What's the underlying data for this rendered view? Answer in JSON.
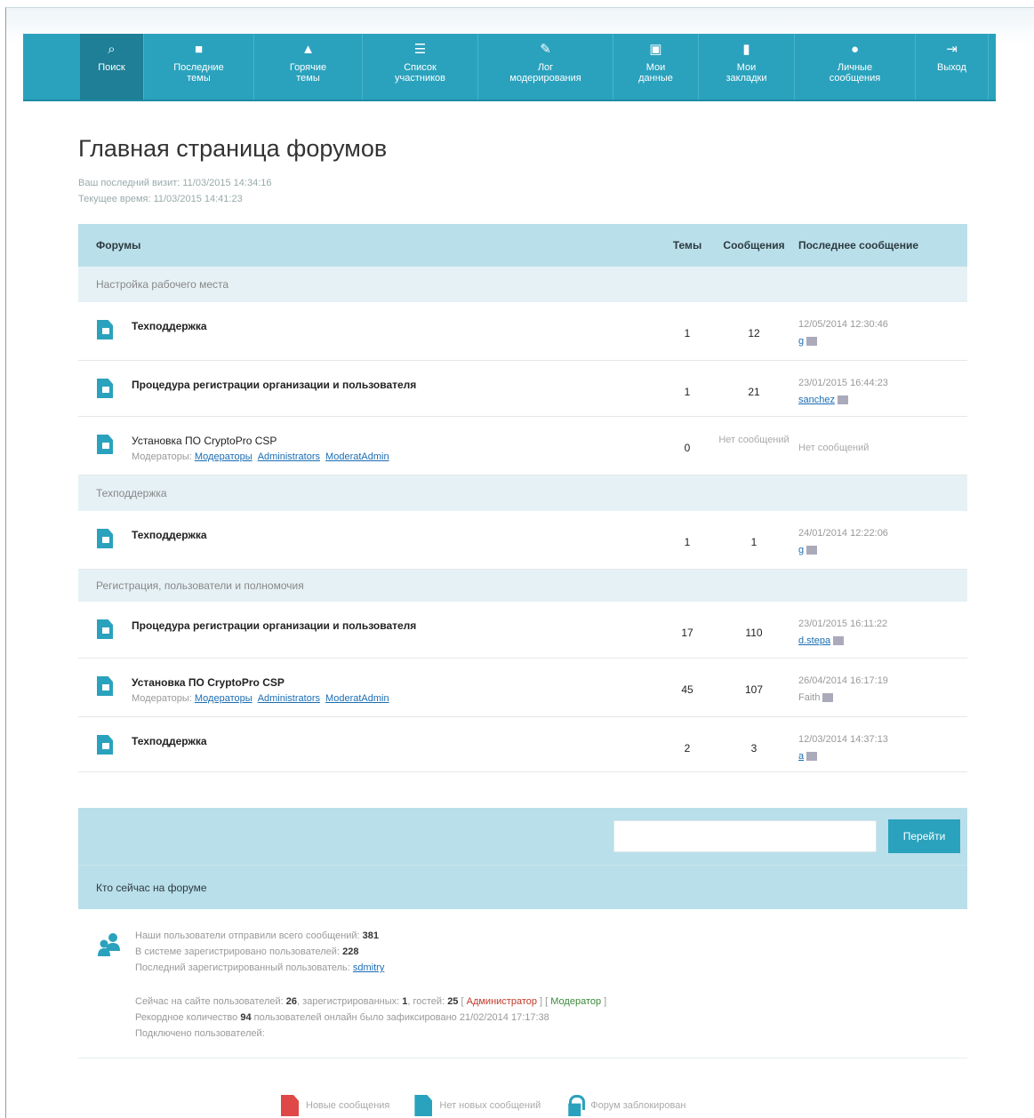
{
  "nav": {
    "items": [
      {
        "label": "Поиск",
        "icon": "search-icon"
      },
      {
        "label": "Последние\nтемы",
        "icon": "document-icon"
      },
      {
        "label": "Горячие\nтемы",
        "icon": "fire-icon"
      },
      {
        "label": "Список\nучастников",
        "icon": "list-icon"
      },
      {
        "label": "Лог\nмодерирования",
        "icon": "edit-icon"
      },
      {
        "label": "Мои\nданные",
        "icon": "profile-card-icon"
      },
      {
        "label": "Мои\nзакладки",
        "icon": "bookmark-icon"
      },
      {
        "label": "Личные\nсообщения",
        "icon": "message-icon"
      },
      {
        "label": "Выход",
        "icon": "logout-icon"
      }
    ],
    "color": "#2aa2bd"
  },
  "page": {
    "title": "Главная страница форумов",
    "last_visit": "Ваш последний визит: 11/03/2015 14:34:16",
    "current_time": "Текущее время: 11/03/2015 14:41:23"
  },
  "table": {
    "headers": {
      "forum": "Форумы",
      "topics": "Темы",
      "posts": "Сообщения",
      "last": "Последнее сообщение"
    }
  },
  "categories": [
    {
      "name": "Настройка рабочего места",
      "forums": [
        {
          "name": "Техподдержка",
          "moderators_label": "",
          "moderators": [],
          "topics": "1",
          "posts": "12",
          "last_date": "12/05/2014 12:30:46",
          "last_by": "g"
        },
        {
          "name": "Процедура регистрации организации и пользователя",
          "moderators_label": "",
          "moderators": [],
          "topics": "1",
          "posts": "21",
          "last_date": "23/01/2015 16:44:23",
          "last_by": "sanchez"
        },
        {
          "name": "Установка ПО CryptoPro CSP",
          "moderators_label": "Модераторы:",
          "moderators": [
            "Модераторы",
            "Administrators",
            "ModeratAdmin"
          ],
          "topics": "0",
          "posts": "Нет сообщений",
          "last_date": "Нет сообщений",
          "last_by": ""
        }
      ]
    },
    {
      "name": "Техподдержка",
      "forums": [
        {
          "name": "Техподдержка",
          "moderators_label": "",
          "moderators": [],
          "topics": "1",
          "posts": "1",
          "last_date": "24/01/2014 12:22:06",
          "last_by": "g"
        }
      ]
    },
    {
      "name": "Регистрация, пользователи и полномочия",
      "forums": [
        {
          "name": "Процедура регистрации организации и пользователя",
          "moderators_label": "",
          "moderators": [],
          "topics": "17",
          "posts": "110",
          "last_date": "23/01/2015 16:11:22",
          "last_by": "d.stepa"
        },
        {
          "name": "Установка ПО CryptoPro CSP",
          "moderators_label": "Модераторы:",
          "moderators": [
            "Модераторы",
            "Administrators",
            "ModeratAdmin"
          ],
          "topics": "45",
          "posts": "107",
          "last_date": "26/04/2014 16:17:19",
          "last_by": "Faith"
        },
        {
          "name": "Техподдержка",
          "moderators_label": "",
          "moderators": [],
          "topics": "2",
          "posts": "3",
          "last_date": "12/03/2014 14:37:13",
          "last_by": "a"
        }
      ]
    }
  ],
  "jump": {
    "input_value": "",
    "button_label": "Перейти"
  },
  "online": {
    "title": "Кто сейчас на форуме",
    "total_posts_label": "Наши пользователи отправили всего сообщений:",
    "total_posts": "381",
    "registered_label": "В системе зарегистрировано пользователей:",
    "registered": "228",
    "newest_label": "Последний зарегистрированный пользователь:",
    "newest_user": "sdmitry",
    "now_label": "Сейчас на сайте пользователей:",
    "now_total": "26",
    "now_registered_label": ", зарегистрированных:",
    "now_registered": "1",
    "now_guests_label": ", гостей:",
    "now_guests": "25",
    "role_admin": "Администратор",
    "role_moderator": "Модератор",
    "record_label": "Рекордное количество",
    "record_value": "94",
    "record_suffix": "пользователей онлайн было зафиксировано 21/02/2014 17:17:38",
    "connected_label": "Подключено пользователей:"
  },
  "legend": {
    "new_posts": "Новые сообщения",
    "no_new_posts": "Нет новых сообщений",
    "locked": "Форум заблокирован"
  }
}
